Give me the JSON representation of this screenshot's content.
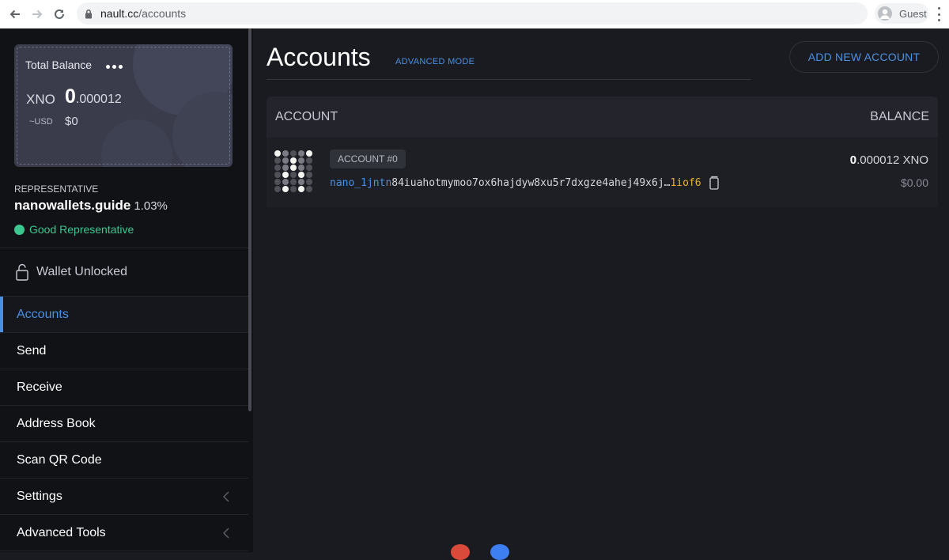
{
  "browser": {
    "url_host": "nault.cc",
    "url_path": "/accounts",
    "profile_label": "Guest",
    "icons": [
      "back-icon",
      "forward-icon",
      "reload-icon",
      "lock-icon",
      "guest-avatar-icon",
      "kebab-menu-icon"
    ]
  },
  "sidebar": {
    "balance": {
      "title": "Total Balance",
      "currency": "XNO",
      "amount_int": "0",
      "amount_dec": ".000012",
      "usd_label": "~USD",
      "usd_value": "$0"
    },
    "representative": {
      "title": "REPRESENTATIVE",
      "name": "nanowallets.guide",
      "weight": "1.03%",
      "status": "Good Representative"
    },
    "wallet_status": "Wallet Unlocked",
    "menu": [
      {
        "label": "Accounts",
        "active": true
      },
      {
        "label": "Send"
      },
      {
        "label": "Receive"
      },
      {
        "label": "Address Book"
      },
      {
        "label": "Scan QR Code"
      },
      {
        "label": "Settings",
        "expandable": true
      },
      {
        "label": "Advanced Tools",
        "expandable": true
      }
    ]
  },
  "main": {
    "title": "Accounts",
    "advanced_mode": "ADVANCED MODE",
    "add_button": "ADD NEW ACCOUNT",
    "table": {
      "col_account": "ACCOUNT",
      "col_balance": "BALANCE",
      "rows": [
        {
          "badge": "ACCOUNT #0",
          "address_prefix": "nano_1jntn",
          "address_middle": "84iuahotmymoo7ox6hajdyw8xu5r7dxgze4ahej49x6j…",
          "address_suffix": "1iof6",
          "balance_int": "0",
          "balance_dec": ".000012 XNO",
          "usd": "$0.00"
        }
      ]
    }
  },
  "colors": {
    "accent": "#4a90e2",
    "good": "#3bc790",
    "address_suffix": "#e6b42d",
    "sidebar_bg": "#111216",
    "main_bg": "#1a1b20"
  }
}
